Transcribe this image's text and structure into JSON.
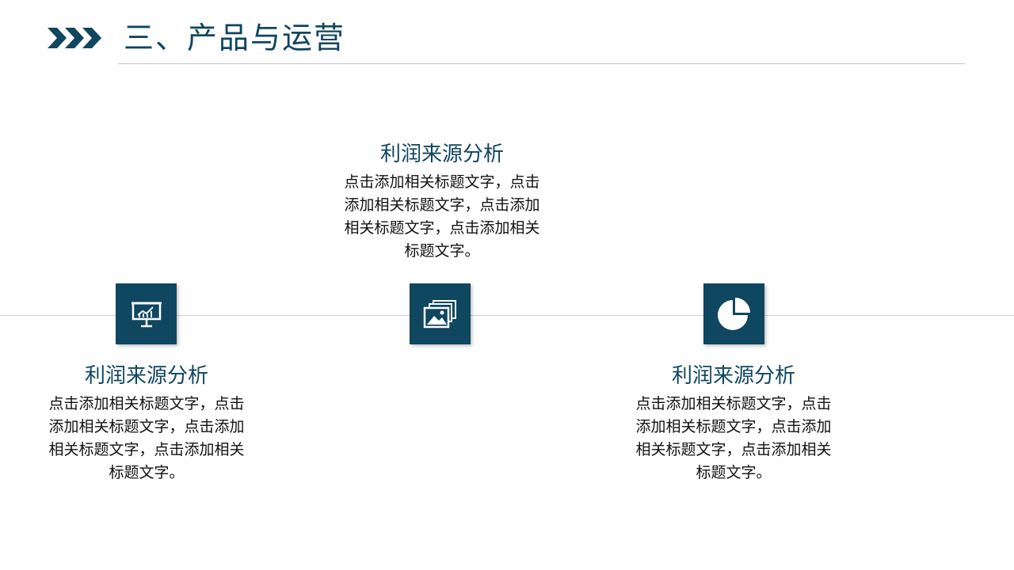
{
  "header": {
    "title": "三、产品与运营"
  },
  "items": [
    {
      "title": "利润来源分析",
      "text": "点击添加相关标题文字，点击添加相关标题文字，点击添加相关标题文字，点击添加相关标题文字。",
      "icon": "presentation-chart-icon"
    },
    {
      "title": "利润来源分析",
      "text": "点击添加相关标题文字，点击添加相关标题文字，点击添加相关标题文字，点击添加相关标题文字。",
      "icon": "image-gallery-icon"
    },
    {
      "title": "利润来源分析",
      "text": "点击添加相关标题文字，点击添加相关标题文字，点击添加相关标题文字，点击添加相关标题文字。",
      "icon": "pie-chart-icon"
    }
  ],
  "colors": {
    "accent": "#0f4660",
    "text": "#111111",
    "rule": "#c4c4c4"
  }
}
